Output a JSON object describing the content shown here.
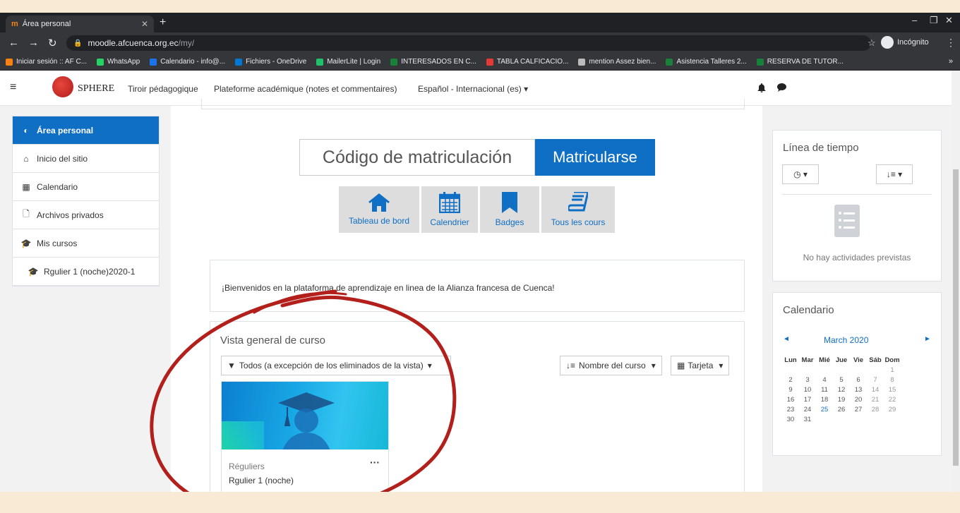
{
  "browser": {
    "tab_title": "Área personal",
    "tab_favicon": "m",
    "url_host": "moodle.afcuenca.org.ec",
    "url_path": "/my/",
    "incognito_label": "Incógnito",
    "bookmarks": [
      {
        "label": "Iniciar sesión :: AF C...",
        "color": "#f98012"
      },
      {
        "label": "WhatsApp",
        "color": "#25d366"
      },
      {
        "label": "Calendario - info@...",
        "color": "#1a73e8"
      },
      {
        "label": "Fichiers - OneDrive",
        "color": "#0078d4"
      },
      {
        "label": "MailerLite | Login",
        "color": "#21c16b"
      },
      {
        "label": "INTERESADOS EN C...",
        "color": "#188038"
      },
      {
        "label": "TABLA CALFICACIO...",
        "color": "#e53935"
      },
      {
        "label": "mention Assez bien...",
        "color": "#bbbbbb"
      },
      {
        "label": "Asistencia Talleres 2...",
        "color": "#188038"
      },
      {
        "label": "RESERVA DE TUTOR...",
        "color": "#188038"
      }
    ]
  },
  "navbar": {
    "brand": "SPHERE",
    "menu": [
      "Tiroir pédagogique",
      "Plateforme académique (notes et commentaires)",
      "Español - Internacional (es)"
    ],
    "accent": "#0f6fc5"
  },
  "drawer": {
    "items": [
      {
        "label": "Área personal",
        "icon": "dashboard-icon"
      },
      {
        "label": "Inicio del sitio",
        "icon": "home-icon"
      },
      {
        "label": "Calendario",
        "icon": "calendar-icon"
      },
      {
        "label": "Archivos privados",
        "icon": "file-icon"
      },
      {
        "label": "Mis cursos",
        "icon": "graduation-cap-icon"
      },
      {
        "label": "Rgulier 1 (noche)2020-1",
        "icon": "graduation-cap-icon"
      }
    ]
  },
  "enrol": {
    "placeholder": "Código de matriculación",
    "button": "Matricularse"
  },
  "shortcuts": [
    {
      "label": "Tableau de bord",
      "icon": "home-icon"
    },
    {
      "label": "Calendrier",
      "icon": "calendar-icon"
    },
    {
      "label": "Badges",
      "icon": "bookmark-icon"
    },
    {
      "label": "Tous les cours",
      "icon": "book-icon"
    }
  ],
  "welcome": "¡Bienvenidos en la plataforma de aprendizaje en linea de la Alianza francesa de Cuenca!",
  "overview": {
    "title": "Vista general de curso",
    "filter": "Todos (a excepción de los eliminados de la vista)",
    "sort": "Nombre del curso",
    "view": "Tarjeta",
    "course": {
      "category": "Réguliers",
      "name": "Rgulier 1 (noche)"
    }
  },
  "timeline": {
    "title": "Línea de tiempo",
    "empty": "No hay actividades previstas"
  },
  "calendar": {
    "title": "Calendario",
    "month": "March 2020",
    "weekdays": [
      "Lun",
      "Mar",
      "Mié",
      "Jue",
      "Vie",
      "Sáb",
      "Dom"
    ],
    "weeks": [
      [
        "",
        "",
        "",
        "",
        "",
        "",
        "1"
      ],
      [
        "2",
        "3",
        "4",
        "5",
        "6",
        "7",
        "8"
      ],
      [
        "9",
        "10",
        "11",
        "12",
        "13",
        "14",
        "15"
      ],
      [
        "16",
        "17",
        "18",
        "19",
        "20",
        "21",
        "22"
      ],
      [
        "23",
        "24",
        "25",
        "26",
        "27",
        "28",
        "29"
      ],
      [
        "30",
        "31",
        "",
        "",
        "",
        "",
        ""
      ]
    ],
    "today": "25"
  }
}
